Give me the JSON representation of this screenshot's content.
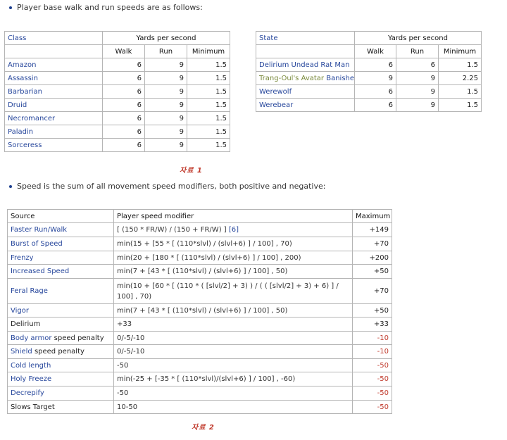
{
  "intro1": "Player base walk and run speeds are as follows:",
  "intro2": "Speed is the sum of all movement speed modifiers, both positive and negative:",
  "caption1": "자료 1",
  "caption2": "자료 2",
  "class_table": {
    "col_class": "Class",
    "col_yps": "Yards per second",
    "col_walk": "Walk",
    "col_run": "Run",
    "col_min": "Minimum",
    "rows": [
      {
        "name": "Amazon",
        "walk": "6",
        "run": "9",
        "min": "1.5"
      },
      {
        "name": "Assassin",
        "walk": "6",
        "run": "9",
        "min": "1.5"
      },
      {
        "name": "Barbarian",
        "walk": "6",
        "run": "9",
        "min": "1.5"
      },
      {
        "name": "Druid",
        "walk": "6",
        "run": "9",
        "min": "1.5"
      },
      {
        "name": "Necromancer",
        "walk": "6",
        "run": "9",
        "min": "1.5"
      },
      {
        "name": "Paladin",
        "walk": "6",
        "run": "9",
        "min": "1.5"
      },
      {
        "name": "Sorceress",
        "walk": "6",
        "run": "9",
        "min": "1.5"
      }
    ]
  },
  "state_table": {
    "col_state": "State",
    "col_yps": "Yards per second",
    "col_walk": "Walk",
    "col_run": "Run",
    "col_min": "Minimum",
    "rows": [
      {
        "name": "Delirium Undead Rat Man",
        "walk": "6",
        "run": "6",
        "min": "1.5"
      },
      {
        "name_part1": "Trang-Oul's Avatar",
        "name_part2": "Banished",
        "walk": "9",
        "run": "9",
        "min": "2.25"
      },
      {
        "name": "Werewolf",
        "walk": "6",
        "run": "9",
        "min": "1.5"
      },
      {
        "name": "Werebear",
        "walk": "6",
        "run": "9",
        "min": "1.5"
      }
    ]
  },
  "mod_table": {
    "col_source": "Source",
    "col_modifier": "Player speed modifier",
    "col_max": "Maximum",
    "rows": [
      {
        "source": "Faster Run/Walk",
        "formula": "[ (150 * FR/W) / (150 + FR/W) ]",
        "ref": "[6]",
        "max": "+149"
      },
      {
        "source": "Burst of Speed",
        "formula": "min(15 + [55 * [ (110*slvl) / (slvl+6) ] / 100] , 70)",
        "max": "+70"
      },
      {
        "source": "Frenzy",
        "formula": "min(20 + [180 * [ (110*slvl) / (slvl+6) ] / 100] , 200)",
        "max": "+200"
      },
      {
        "source": "Increased Speed",
        "formula": "min(7 + [43 * [ (110*slvl) / (slvl+6) ] / 100] , 50)",
        "max": "+50"
      },
      {
        "source": "Feral Rage",
        "formula": "min(10 + [60 * [ (110 * ( [slvl/2] + 3) ) / ( ( [slvl/2] + 3) + 6) ] / 100] , 70)",
        "max": "+70"
      },
      {
        "source": "Vigor",
        "formula": "min(7 + [43 * [ (110*slvl) / (slvl+6) ] / 100] , 50)",
        "max": "+50"
      },
      {
        "source": "Delirium",
        "formula": "+33",
        "max": "+33"
      },
      {
        "source_part1": "Body armor",
        "source_part2": "speed penalty",
        "formula": "0/-5/-10",
        "max": "-10"
      },
      {
        "source_part1": "Shield",
        "source_part2": "speed penalty",
        "formula": "0/-5/-10",
        "max": "-10"
      },
      {
        "source": "Cold length",
        "formula": "-50",
        "max": "-50"
      },
      {
        "source": "Holy Freeze",
        "formula": "min(-25 + [-35 * [ (110*slvl)/(slvl+6) ] / 100] , -60)",
        "max": "-50"
      },
      {
        "source": "Decrepify",
        "formula": "-50",
        "max": "-50"
      },
      {
        "source": "Slows Target",
        "formula": "10-50",
        "max": "-50"
      }
    ]
  }
}
